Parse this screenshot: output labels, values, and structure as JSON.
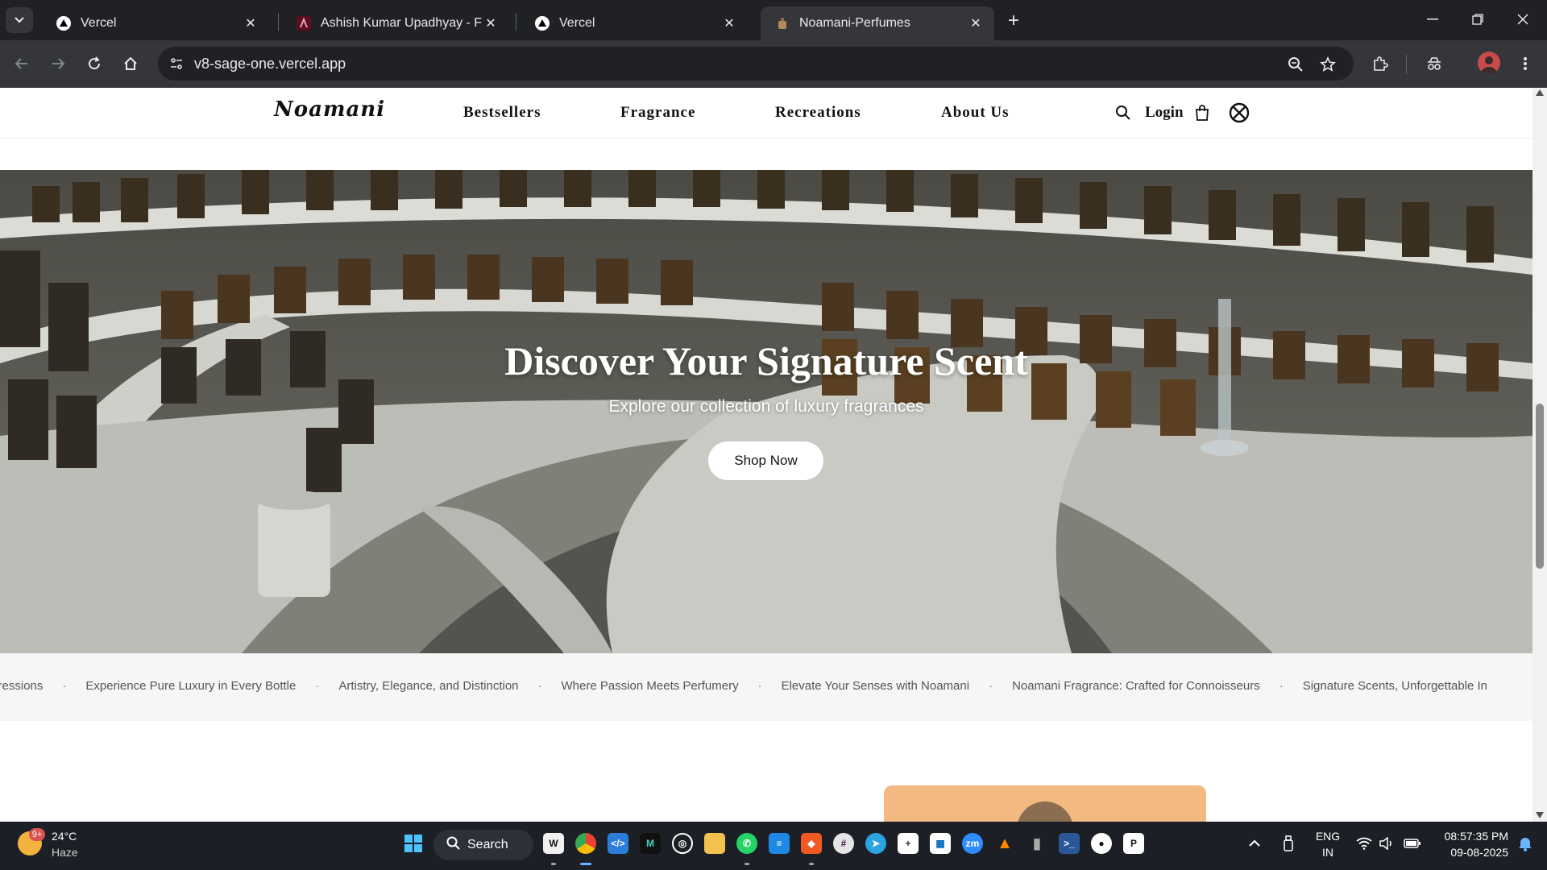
{
  "browser": {
    "tabs": [
      {
        "title": "Vercel",
        "favicon": "vercel-triangle-icon",
        "active": false
      },
      {
        "title": "Ashish Kumar Upadhyay - Full S",
        "favicon": "portfolio-icon",
        "active": false
      },
      {
        "title": "Vercel",
        "favicon": "vercel-triangle-icon",
        "active": false
      },
      {
        "title": "Noamani-Perfumes",
        "favicon": "perfume-icon",
        "active": true
      }
    ],
    "url": "v8-sage-one.vercel.app"
  },
  "site": {
    "logo": "Noamani",
    "nav": [
      "Bestsellers",
      "Fragrance",
      "Recreations",
      "About Us"
    ],
    "login_label": "Login",
    "hero": {
      "title": "Discover Your Signature Scent",
      "subtitle": "Explore our collection of luxury fragrances",
      "cta_label": "Shop Now"
    },
    "marquee": [
      "able Impressions",
      "Experience Pure Luxury in Every Bottle",
      "Artistry, Elegance, and Distinction",
      "Where Passion Meets Perfumery",
      "Elevate Your Senses with Noamani",
      "Noamani Fragrance: Crafted for Connoisseurs",
      "Signature Scents, Unforgettable In"
    ],
    "marquee_separator": "·"
  },
  "taskbar": {
    "weather": {
      "temp": "24°C",
      "condition": "Haze",
      "badge": "9+"
    },
    "search_label": "Search",
    "language": {
      "line1": "ENG",
      "line2": "IN"
    },
    "clock": {
      "time": "08:57:35 PM",
      "date": "09-08-2025"
    }
  },
  "colors": {
    "chrome_dark": "#202124",
    "chrome_toolbar": "#35363a",
    "taskbar": "#1c1f26",
    "marquee_bg": "#f6f6f6",
    "card_peach": "#f2b980"
  }
}
